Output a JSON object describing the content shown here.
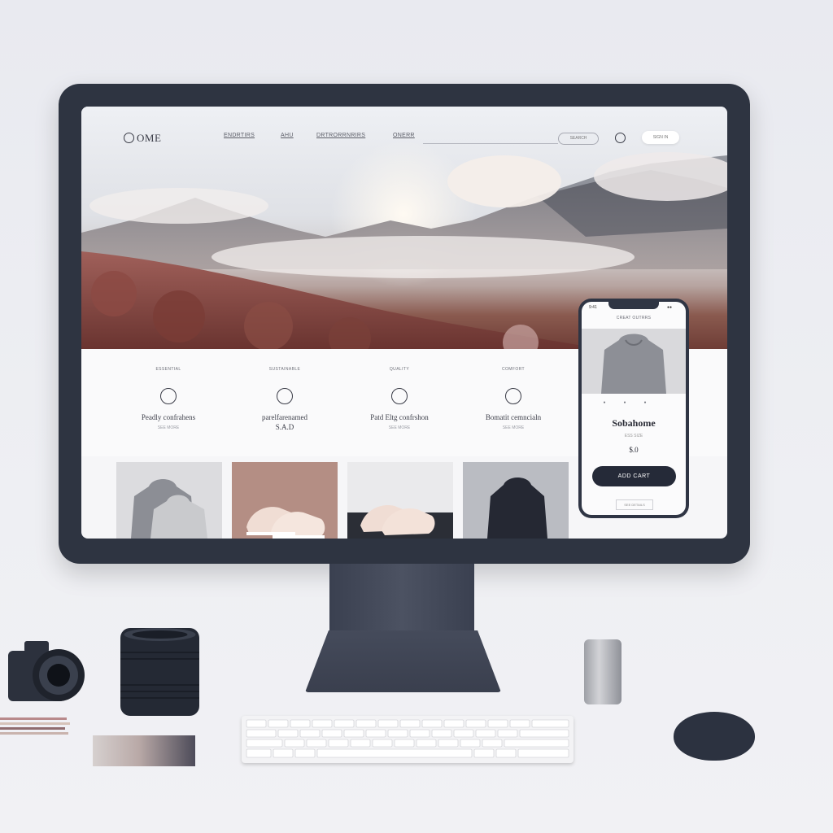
{
  "nav": {
    "logo": "OME",
    "links": [
      "ENDRTIRS",
      "AHU",
      "DRTRORRNRIRS",
      "ONERR"
    ],
    "search_placeholder": "SEARCH",
    "signin_label": "SIGN IN"
  },
  "features": [
    {
      "title": "ESSENTIAL",
      "text": "Peadly confrahens",
      "sub": "SEE MORE"
    },
    {
      "title": "SUSTAINABLE",
      "text": "parelfarenamed\nS.A.D",
      "sub": ""
    },
    {
      "title": "QUALITY",
      "text": "Patd Eltg confrshon",
      "sub": "SEE MORE"
    },
    {
      "title": "COMFORT",
      "text": "Bomatit cemncialn",
      "sub": "SEE MORE"
    }
  ],
  "phone": {
    "status_left": "9:41",
    "status_right": "●●",
    "header": "CREAT OUTRRS",
    "product_title": "Sobahome",
    "product_sub": "ESS SIZE",
    "price": "$.0",
    "add_cart_label": "ADD CART",
    "footer_link": "SEE DETAILS"
  },
  "colors": {
    "bezel": "#2e3441",
    "accent_dark": "#252a38",
    "page_bg": "#eceef2"
  }
}
